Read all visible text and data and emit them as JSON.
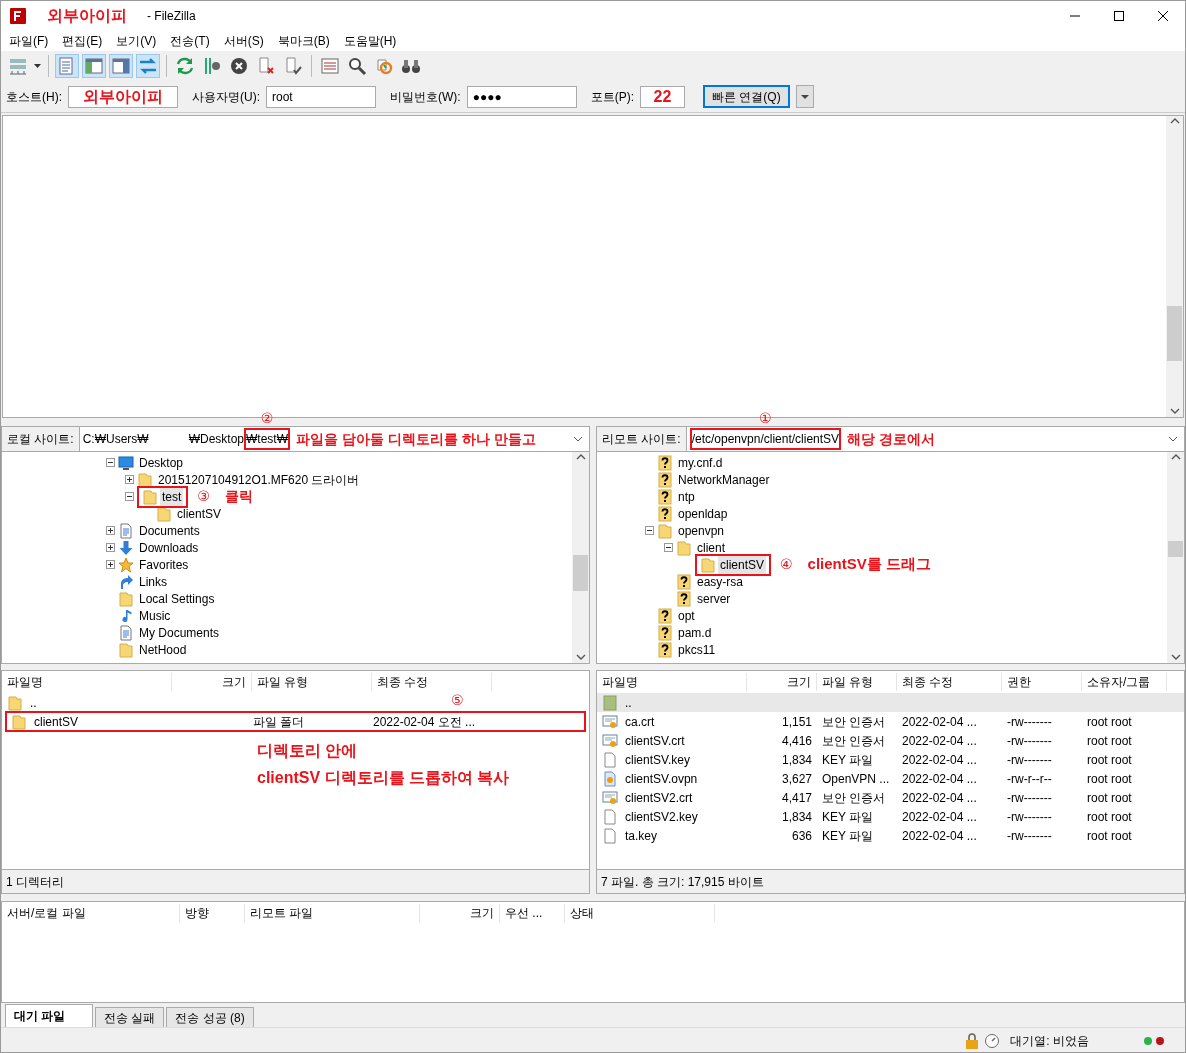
{
  "window": {
    "title_note": "외부아이피",
    "title": "- FileZilla"
  },
  "menu": [
    "파일(F)",
    "편집(E)",
    "보기(V)",
    "전송(T)",
    "서버(S)",
    "북마크(B)",
    "도움말(H)"
  ],
  "view_toggles": [
    {
      "on": true
    },
    {
      "on": true
    },
    {
      "on": true
    },
    {
      "on": true
    }
  ],
  "quickconnect": {
    "fields": [
      {
        "label": "호스트(H):",
        "value": "외부아이피",
        "emphasis": true,
        "kind": "host"
      },
      {
        "label": "사용자명(U):",
        "value": "root",
        "emphasis": false,
        "kind": "user"
      },
      {
        "label": "비밀번호(W):",
        "value": "●●●●",
        "emphasis": false,
        "kind": "password"
      },
      {
        "label": "포트(P):",
        "value": "22",
        "emphasis": true,
        "kind": "port"
      }
    ],
    "connect_button": "빠른 연결(Q)"
  },
  "local": {
    "site_label": "로컬 사이트:",
    "path": [
      {
        "text": "C:₩Users₩",
        "highlighted": false
      },
      {
        "text": "₩Desktop",
        "highlighted": false
      },
      {
        "text": "₩test₩",
        "highlighted": true
      }
    ],
    "path_step": "②",
    "path_note": "파일을 담아둘 디렉토리를 하나 만들고",
    "tree": [
      {
        "label": "Desktop",
        "kind": "desktop",
        "expanded": true,
        "selected": false,
        "highlighted": false,
        "children": [
          {
            "label": "20151207104912O1.MF620 드라이버",
            "kind": "folder",
            "expanded": false,
            "selected": false,
            "highlighted": false
          },
          {
            "label": "test",
            "kind": "folder",
            "expanded": true,
            "selected": true,
            "highlighted": true,
            "step": "③",
            "note": "클릭",
            "children": [
              {
                "label": "clientSV",
                "kind": "folder",
                "selected": false,
                "highlighted": false
              }
            ]
          }
        ]
      },
      {
        "label": "Documents",
        "kind": "documents",
        "expanded": false,
        "selected": false,
        "highlighted": false
      },
      {
        "label": "Downloads",
        "kind": "downloads",
        "expanded": false,
        "selected": false,
        "highlighted": false
      },
      {
        "label": "Favorites",
        "kind": "favorites",
        "expanded": false,
        "selected": false,
        "highlighted": false
      },
      {
        "label": "Links",
        "kind": "links",
        "selected": false,
        "highlighted": false
      },
      {
        "label": "Local Settings",
        "kind": "folder",
        "selected": false,
        "highlighted": false
      },
      {
        "label": "Music",
        "kind": "music",
        "selected": false,
        "highlighted": false
      },
      {
        "label": "My Documents",
        "kind": "documents",
        "selected": false,
        "highlighted": false
      },
      {
        "label": "NetHood",
        "kind": "folder",
        "selected": false,
        "highlighted": false
      }
    ],
    "columns": [
      "파일명",
      "크기",
      "파일 유형",
      "최종 수정"
    ],
    "files": [
      {
        "kind": "folder",
        "name": "..",
        "selected": false,
        "highlighted": false
      },
      {
        "kind": "folder",
        "name": "clientSV",
        "type": "파일 폴더",
        "modified": "2022-02-04 오전 ...",
        "selected": false,
        "highlighted": true,
        "step": "⑤"
      }
    ],
    "notes": [
      "디렉토리 안에",
      "clientSV 디렉토리를 드롭하여 복사"
    ],
    "status": "1 디렉터리"
  },
  "remote": {
    "site_label": "리모트 사이트:",
    "path": [
      {
        "text": "/etc/openvpn/client/clientSV",
        "highlighted": true
      }
    ],
    "path_step": "①",
    "path_note": "해당 경로에서",
    "tree": [
      {
        "label": "my.cnf.d",
        "kind": "unknown",
        "selected": false,
        "highlighted": false
      },
      {
        "label": "NetworkManager",
        "kind": "unknown",
        "selected": false,
        "highlighted": false
      },
      {
        "label": "ntp",
        "kind": "unknown",
        "selected": false,
        "highlighted": false
      },
      {
        "label": "openldap",
        "kind": "unknown",
        "selected": false,
        "highlighted": false
      },
      {
        "label": "openvpn",
        "kind": "folder",
        "expanded": true,
        "selected": false,
        "highlighted": false,
        "children": [
          {
            "label": "client",
            "kind": "folder",
            "expanded": true,
            "selected": false,
            "highlighted": false,
            "children": [
              {
                "label": "clientSV",
                "kind": "folder",
                "selected": true,
                "highlighted": true,
                "step": "④",
                "note": "clientSV를 드래그"
              }
            ]
          },
          {
            "label": "easy-rsa",
            "kind": "unknown",
            "selected": false,
            "highlighted": false
          },
          {
            "label": "server",
            "kind": "unknown",
            "selected": false,
            "highlighted": false
          }
        ]
      },
      {
        "label": "opt",
        "kind": "unknown",
        "selected": false,
        "highlighted": false
      },
      {
        "label": "pam.d",
        "kind": "unknown",
        "selected": false,
        "highlighted": false
      },
      {
        "label": "pkcs11",
        "kind": "unknown",
        "selected": false,
        "highlighted": false
      }
    ],
    "columns": [
      "파일명",
      "크기",
      "파일 유형",
      "최종 수정",
      "권한",
      "소유자/그룹"
    ],
    "files": [
      {
        "kind": "parent",
        "name": "..",
        "selected": true,
        "highlighted": false
      },
      {
        "kind": "cert",
        "name": "ca.crt",
        "size": "1,151",
        "type": "보안 인증서",
        "modified": "2022-02-04 ...",
        "permissions": "-rw-------",
        "owner": "root root",
        "selected": false,
        "highlighted": false
      },
      {
        "kind": "cert",
        "name": "clientSV.crt",
        "size": "4,416",
        "type": "보안 인증서",
        "modified": "2022-02-04 ...",
        "permissions": "-rw-------",
        "owner": "root root",
        "selected": false,
        "highlighted": false
      },
      {
        "kind": "file",
        "name": "clientSV.key",
        "size": "1,834",
        "type": "KEY 파일",
        "modified": "2022-02-04 ...",
        "permissions": "-rw-------",
        "owner": "root root",
        "selected": false,
        "highlighted": false
      },
      {
        "kind": "ovpn",
        "name": "clientSV.ovpn",
        "size": "3,627",
        "type": "OpenVPN ...",
        "modified": "2022-02-04 ...",
        "permissions": "-rw-r--r--",
        "owner": "root root",
        "selected": false,
        "highlighted": false
      },
      {
        "kind": "cert",
        "name": "clientSV2.crt",
        "size": "4,417",
        "type": "보안 인증서",
        "modified": "2022-02-04 ...",
        "permissions": "-rw-------",
        "owner": "root root",
        "selected": false,
        "highlighted": false
      },
      {
        "kind": "file",
        "name": "clientSV2.key",
        "size": "1,834",
        "type": "KEY 파일",
        "modified": "2022-02-04 ...",
        "permissions": "-rw-------",
        "owner": "root root",
        "selected": false,
        "highlighted": false
      },
      {
        "kind": "file",
        "name": "ta.key",
        "size": "636",
        "type": "KEY 파일",
        "modified": "2022-02-04 ...",
        "permissions": "-rw-------",
        "owner": "root root",
        "selected": false,
        "highlighted": false
      }
    ],
    "status": "7 파일. 총 크기: 17,915 바이트"
  },
  "queue": {
    "columns": [
      "서버/로컬 파일",
      "방향",
      "리모트 파일",
      "크기",
      "우선 ...",
      "상태"
    ],
    "tabs": [
      {
        "label": "대기 파일",
        "selected": true
      },
      {
        "label": "전송 실패",
        "selected": false
      },
      {
        "label": "전송 성공 (8)",
        "selected": false
      }
    ],
    "status": "대기열: 비었음"
  }
}
